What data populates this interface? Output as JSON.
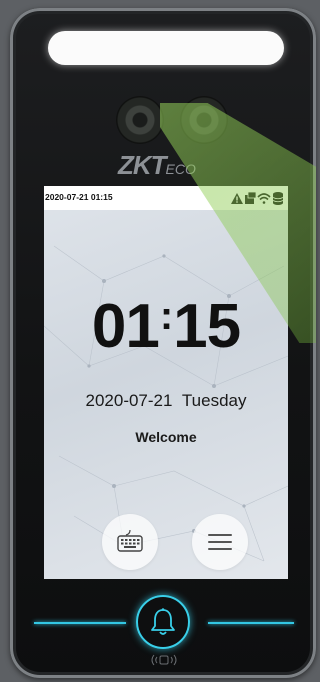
{
  "device": {
    "brand_main": "ZKT",
    "brand_suffix": "ECO"
  },
  "status_bar": {
    "datetime": "2020-07-21 01:15",
    "icons": [
      "alert-triangle-icon",
      "card-icon",
      "wifi-icon",
      "database-icon"
    ]
  },
  "main": {
    "clock_hours": "01",
    "clock_separator": ":",
    "clock_minutes": "15",
    "date": "2020-07-21",
    "weekday": "Tuesday",
    "greeting": "Welcome"
  },
  "buttons": {
    "keyboard_icon": "keyboard-icon",
    "menu_icon": "menu-icon",
    "doorbell_icon": "bell-icon"
  },
  "colors": {
    "accent_cyan": "#33c7e3",
    "sensor_green": "#96d25a"
  }
}
